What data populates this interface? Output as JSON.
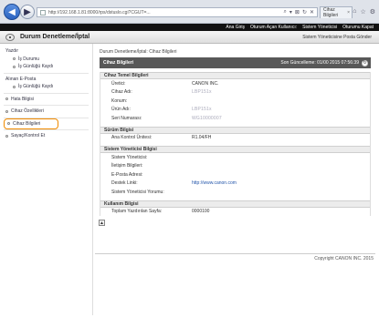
{
  "browser": {
    "url": "http://192.168.1.81:8000/rps/dstuslo.cgi?CGUT=...",
    "tab_label": "Cihaz Bilgileri",
    "tab_close": "×",
    "addr_tools": [
      "⌕",
      "▾",
      "⊠",
      "↻",
      "✕"
    ],
    "win_tools": [
      "⌂",
      "☆",
      "⚙"
    ]
  },
  "topbar": {
    "links": [
      "Ana Giriş",
      "Oturum Açan Kullanıcı:",
      "Sistem Yöneticisi",
      "Oturumu Kapat"
    ]
  },
  "header": {
    "title": "Durum Denetleme/İptal",
    "mail_button": "Sistem Yöneticisine Posta Gönder"
  },
  "sidebar": {
    "sections": [
      {
        "label": "Yazdır",
        "items": [
          "İş Durumu",
          "İş Günlüğü Kaydı"
        ]
      },
      {
        "label": "Alınan E-Posta",
        "items": [
          "İş Günlüğü Kaydı"
        ]
      }
    ],
    "top_items": [
      "Hata Bilgisi",
      "Cihaz Özellikleri",
      "Cihaz Bilgileri",
      "Sayaç/Kontrol Et"
    ]
  },
  "main": {
    "breadcrumb": "Durum Denetleme/İptal: Cihaz Bilgileri",
    "page_title": "Cihaz Bilgileri",
    "head_label": "Cihaz Bilgileri",
    "last_update": "Son Güncelleme: 01/00 2015 07:56:39",
    "sections": [
      {
        "title": "Cihaz Temel Bilgileri",
        "rows": [
          {
            "label": "Üretici:",
            "value": "CANON INC.",
            "style": "normal"
          },
          {
            "label": "Cihaz Adı:",
            "value": "LBP151x",
            "style": "blur"
          },
          {
            "label": "Konum:",
            "value": "",
            "style": "normal"
          },
          {
            "label": "Ürün Adı:",
            "value": "LBP151x",
            "style": "blur"
          },
          {
            "label": "Seri Numarası:",
            "value": "WG10000007",
            "style": "blur"
          }
        ]
      },
      {
        "title": "Sürüm Bilgisi",
        "rows": [
          {
            "label": "Ana Kontrol Ünitesi:",
            "value": "R1.04/FH",
            "style": "normal"
          }
        ]
      },
      {
        "title": "Sistem Yöneticisi Bilgisi",
        "rows": [
          {
            "label": "Sistem Yöneticisi:",
            "value": "",
            "style": "normal"
          },
          {
            "label": "İletişim Bilgileri:",
            "value": "",
            "style": "normal"
          },
          {
            "label": "E-Posta Adresi:",
            "value": "",
            "style": "normal"
          },
          {
            "label": "Destek Linki:",
            "value": "http://www.canon.com",
            "style": "link"
          },
          {
            "label": "Sistem Yöneticisi Yorumu:",
            "value": "",
            "style": "normal"
          }
        ]
      },
      {
        "title": "Kullanım Bilgisi",
        "rows": [
          {
            "label": "Toplam Yazdırılan Sayfa:",
            "value": "0000100",
            "style": "normal"
          }
        ]
      }
    ],
    "back_top": "▲"
  },
  "footer": {
    "copyright": "Copyright CANON INC. 2015"
  },
  "icons": [
    "back-arrow-icon",
    "forward-arrow-icon",
    "page-icon",
    "home-icon",
    "refresh-icon",
    "bullet-icon"
  ],
  "colors": {
    "highlight": "#f08a00",
    "topbar": "#111111",
    "section_head": "#585858"
  }
}
